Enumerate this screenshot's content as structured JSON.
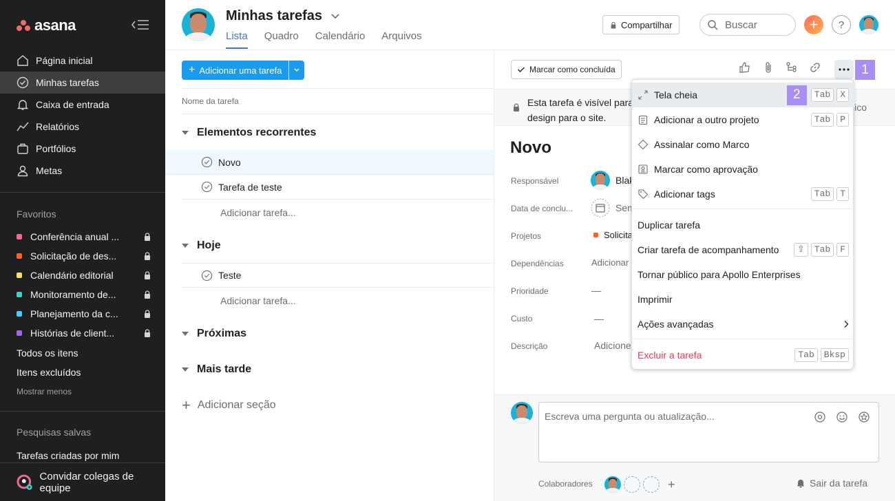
{
  "sidebar": {
    "logo": "asana",
    "nav": [
      {
        "label": "Página inicial",
        "icon": "home-icon"
      },
      {
        "label": "Minhas tarefas",
        "icon": "check-circle-icon",
        "active": true
      },
      {
        "label": "Caixa de entrada",
        "icon": "bell-icon"
      },
      {
        "label": "Relatórios",
        "icon": "trend-line-icon"
      },
      {
        "label": "Portfólios",
        "icon": "folder-icon"
      },
      {
        "label": "Metas",
        "icon": "person-icon"
      }
    ],
    "favorites_title": "Favoritos",
    "favorites": [
      {
        "label": "Conferência anual ...",
        "color": "#f06a99"
      },
      {
        "label": "Solicitação de des...",
        "color": "#fd612c"
      },
      {
        "label": "Calendário editorial",
        "color": "#f8df72"
      },
      {
        "label": "Monitoramento de...",
        "color": "#4ecbc4"
      },
      {
        "label": "Planejamento da c...",
        "color": "#4ecbf5"
      },
      {
        "label": "Histórias de client...",
        "color": "#aa62e3"
      }
    ],
    "all_items": "Todos os itens",
    "deleted_items": "Itens excluídos",
    "show_less": "Mostrar menos",
    "saved_searches_title": "Pesquisas salvas",
    "saved_search_1": "Tarefas criadas por mim",
    "invite": "Convidar colegas de equipe"
  },
  "header": {
    "title": "Minhas tarefas",
    "tabs": [
      "Lista",
      "Quadro",
      "Calendário",
      "Arquivos"
    ],
    "share": "Compartilhar",
    "search_placeholder": "Buscar",
    "help": "?"
  },
  "list": {
    "add_task": "Adicionar uma tarefa",
    "column_header": "Nome da tarefa",
    "sections": {
      "recurring": "Elementos recorrentes",
      "today": "Hoje",
      "upcoming": "Próximas",
      "later": "Mais tarde"
    },
    "tasks": {
      "novo": "Novo",
      "test_task": "Tarefa de teste",
      "teste": "Teste"
    },
    "add_task_row": "Adicionar tarefa...",
    "add_section": "Adicionar seção"
  },
  "detail": {
    "mark_complete": "Marcar como concluída",
    "badge_1": "1",
    "banner_text": "Esta tarefa é visível para design para o site.",
    "banner_tail": "lico",
    "task_title": "Novo",
    "fields": {
      "assignee_label": "Responsável",
      "assignee_value": "Blak",
      "due_label": "Data de conclu...",
      "due_value": "Sem",
      "projects_label": "Projetos",
      "projects_value": "Solicita",
      "deps_label": "Dependências",
      "deps_value": "Adicionar d",
      "priority_label": "Prioridade",
      "priority_value": "—",
      "cost_label": "Custo",
      "cost_value": "—",
      "desc_label": "Descrição",
      "desc_value": "Adicione"
    },
    "comment_placeholder": "Escreva uma pergunta ou atualização...",
    "collaborators": "Colaboradores",
    "leave_task": "Sair da tarefa"
  },
  "menu": {
    "badge_2": "2",
    "items": {
      "fullscreen": "Tela cheia",
      "add_project": "Adicionar a outro projeto",
      "milestone": "Assinalar como Marco",
      "approval": "Marcar como aprovação",
      "tags": "Adicionar tags",
      "duplicate": "Duplicar tarefa",
      "followup": "Criar tarefa de acompanhamento",
      "make_public": "Tornar público para Apollo Enterprises",
      "print": "Imprimir",
      "advanced": "Ações avançadas",
      "delete": "Excluir a tarefa"
    },
    "keys": {
      "tab": "Tab",
      "x": "X",
      "p": "P",
      "t": "T",
      "shift": "⇧",
      "f": "F",
      "bksp": "Bksp"
    }
  },
  "colors": {
    "sidebar_bg": "#1e1f21",
    "accent": "#4573d2",
    "primary_button": "#1a9bf0",
    "danger": "#e8384f",
    "badge": "#a98ff5"
  }
}
